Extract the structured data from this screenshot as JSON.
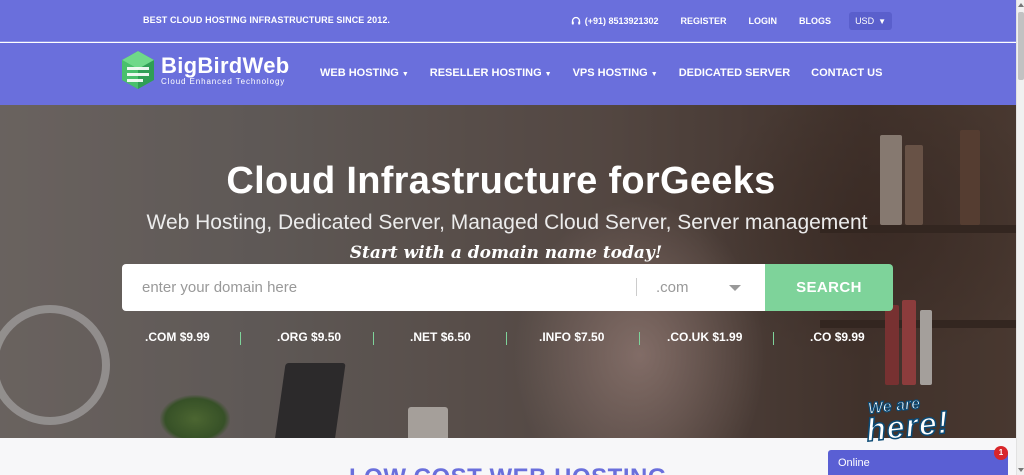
{
  "topbar": {
    "tagline": "BEST CLOUD HOSTING INFRASTRUCTURE SINCE 2012.",
    "phone": "(+91) 8513921302",
    "register": "REGISTER",
    "login": "LOGIN",
    "blogs": "BLOGS",
    "currency": "USD"
  },
  "logo": {
    "name": "BigBirdWeb",
    "subtitle": "Cloud Enhanced Technology",
    "colors": {
      "light": "#6fd98a",
      "dark": "#2f9e55"
    }
  },
  "nav": {
    "items": [
      {
        "label": "WEB HOSTING",
        "dropdown": true
      },
      {
        "label": "RESELLER HOSTING",
        "dropdown": true
      },
      {
        "label": "VPS HOSTING",
        "dropdown": true
      },
      {
        "label": "DEDICATED SERVER",
        "dropdown": false
      },
      {
        "label": "CONTACT US",
        "dropdown": false
      }
    ]
  },
  "hero": {
    "title": "Cloud Infrastructure forGeeks",
    "subtitle": "Web Hosting, Dedicated Server, Managed Cloud Server, Server management",
    "cta": "Start with a domain name today!",
    "search": {
      "placeholder": "enter your domain here",
      "tld_selected": ".com",
      "button": "SEARCH"
    },
    "prices": [
      {
        "tld": ".COM",
        "price": "$9.99"
      },
      {
        "tld": ".ORG",
        "price": "$9.50"
      },
      {
        "tld": ".NET",
        "price": "$6.50"
      },
      {
        "tld": ".INFO",
        "price": "$7.50"
      },
      {
        "tld": ".CO.UK",
        "price": "$1.99"
      },
      {
        "tld": ".CO",
        "price": "$9.99"
      }
    ]
  },
  "badge": {
    "line1": "We are",
    "line2": "here!"
  },
  "section": {
    "headline": "LOW COST WEB HOSTING"
  },
  "chat": {
    "label": "Online",
    "count": "1"
  },
  "colors": {
    "brand": "#6a6fdc",
    "accent": "#7ed39a",
    "chat": "#5a5fd4",
    "badge": "#d9262b"
  }
}
